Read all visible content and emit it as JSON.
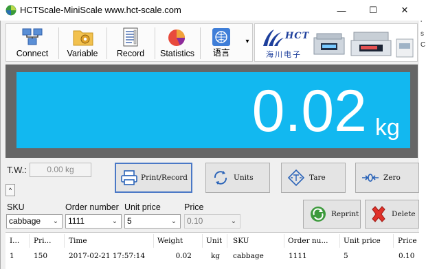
{
  "window": {
    "title": "HCTScale-MiniScale www.hct-scale.com",
    "minimize": "—",
    "maximize": "☐",
    "close": "✕"
  },
  "toolbar": {
    "items": [
      {
        "label": "Connect",
        "icon": "network-connect-icon"
      },
      {
        "label": "Variable",
        "icon": "folder-gear-icon"
      },
      {
        "label": "Record",
        "icon": "document-list-icon"
      },
      {
        "label": "Statistics",
        "icon": "pie-chart-icon"
      },
      {
        "label": "语言",
        "icon": "globe-language-icon"
      }
    ],
    "overflow": "▾"
  },
  "banner": {
    "brand": "HCT",
    "brand_cn": "海川电子"
  },
  "display": {
    "weight": "0.02",
    "unit": "kg",
    "background": "#12b8f0"
  },
  "tare_weight": {
    "label": "T.W.:",
    "value": "0.00 kg"
  },
  "collapse": "^",
  "buttons": {
    "print": "Print/Record",
    "units": "Units",
    "tare": "Tare",
    "zero": "Zero",
    "reprint": "Reprint",
    "delete": "Delete"
  },
  "form": {
    "sku": {
      "label": "SKU",
      "value": "cabbage"
    },
    "order_number": {
      "label": "Order number",
      "value": "1111"
    },
    "unit_price": {
      "label": "Unit price",
      "value": "5"
    },
    "price": {
      "label": "Price",
      "value": "0.10"
    }
  },
  "table": {
    "columns": [
      "I...",
      "Pri...",
      "Time",
      "Weight",
      "Unit",
      "SKU",
      "Order nu...",
      "Unit price",
      "Price"
    ],
    "rows": [
      [
        "1",
        "150",
        "2017-02-21 17:57:14",
        "0.02",
        "kg",
        "cabbage",
        "1111",
        "5",
        "0.10"
      ]
    ]
  },
  "background_window_text": [
    "e",
    "r",
    "s",
    "C"
  ]
}
